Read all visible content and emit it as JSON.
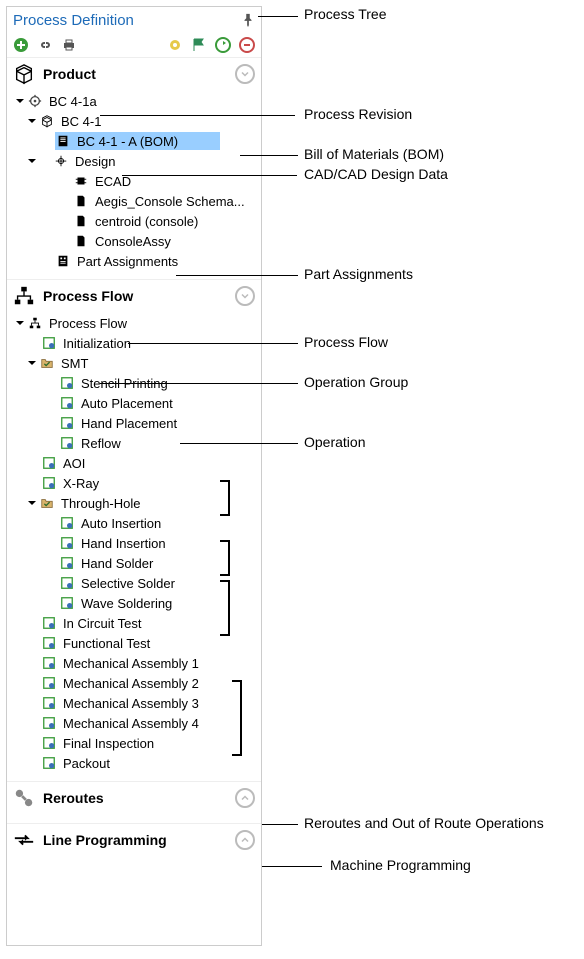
{
  "panel": {
    "title": "Process Definition"
  },
  "sections": {
    "product": {
      "label": "Product"
    },
    "flow": {
      "label": "Process Flow"
    },
    "reroutes": {
      "label": "Reroutes"
    },
    "lineprog": {
      "label": "Line Programming"
    }
  },
  "product_tree": {
    "rev": "BC 4-1a",
    "bc41": "BC 4-1",
    "bom": "BC 4-1 - A (BOM)",
    "design": "Design",
    "ecad": "ECAD",
    "aegis": "Aegis_Console Schema...",
    "centroid": "centroid (console)",
    "console": "ConsoleAssy",
    "parts": "Part Assignments"
  },
  "flow_tree": {
    "root": "Process Flow",
    "init": "Initialization",
    "smt": "SMT",
    "stencil": "Stencil Printing",
    "auto_place": "Auto Placement",
    "hand_place": "Hand Placement",
    "reflow": "Reflow",
    "aoi": "AOI",
    "xray": "X-Ray",
    "th": "Through-Hole",
    "auto_ins": "Auto Insertion",
    "hand_ins": "Hand Insertion",
    "hand_solder": "Hand Solder",
    "sel_solder": "Selective Solder",
    "wave": "Wave Soldering",
    "ict": "In Circuit Test",
    "func": "Functional Test",
    "ma1": "Mechanical Assembly 1",
    "ma2": "Mechanical Assembly 2",
    "ma3": "Mechanical Assembly 3",
    "ma4": "Mechanical Assembly 4",
    "final": "Final Inspection",
    "packout": "Packout"
  },
  "annotations": {
    "tree": "Process Tree",
    "rev": "Process Revision",
    "bom": "Bill of Materials (BOM)",
    "design": "CAD/CAD Design Data",
    "parts": "Part Assignments",
    "flow": "Process Flow",
    "opgroup": "Operation Group",
    "op": "Operation",
    "reroutes": "Reroutes and Out of Route Operations",
    "machine": "Machine Programming"
  }
}
